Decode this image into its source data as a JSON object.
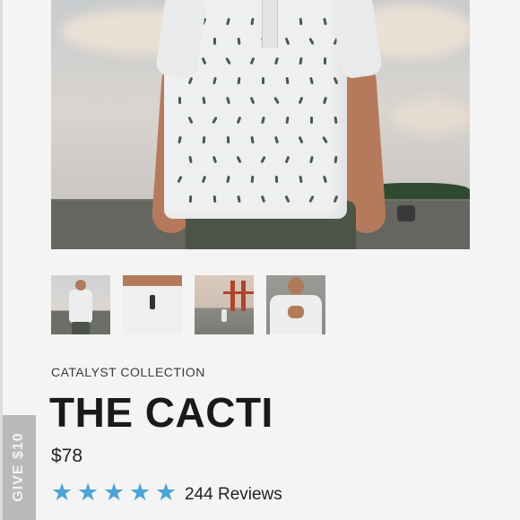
{
  "product": {
    "collection": "CATALYST COLLECTION",
    "name": "THE CACTI",
    "price": "$78",
    "rating": {
      "stars": 5,
      "max": 5,
      "reviews_label": "244 Reviews",
      "star_color": "#4aa4d4"
    }
  },
  "gallery": {
    "thumbnails": [
      {
        "icon": "front-view-thumbnail"
      },
      {
        "icon": "close-up-thumbnail"
      },
      {
        "icon": "golden-gate-bridge-thumbnail"
      },
      {
        "icon": "buttoning-shirt-thumbnail"
      }
    ]
  },
  "side_tab": {
    "label": "GIVE $10",
    "color": "#b9b9b9"
  }
}
